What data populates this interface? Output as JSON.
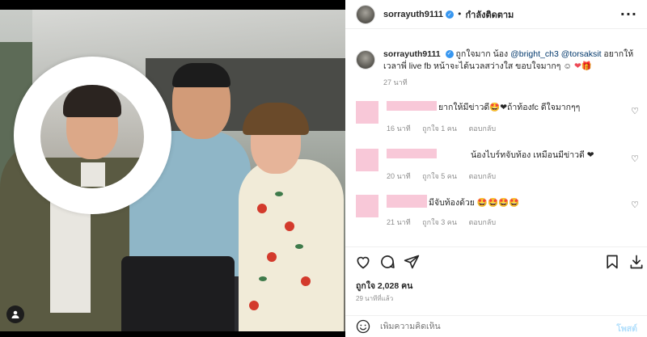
{
  "post": {
    "username": "sorrayuth9111",
    "follow_status": "กำลังติดตาม",
    "more_icon": "more-dots-icon",
    "caption": {
      "username": "sorrayuth9111",
      "text_before": "ถูกใจมาก น้อง ",
      "mention1": "@bright_ch3",
      "mention2": "@torsaksit",
      "text_after": " อยากให้เวลาพี่ live fb หน้าจะได้นวลสว่างใส ขอบใจมากๆ ☺",
      "emoji": "❤🎁",
      "time": "27 นาที"
    },
    "comments": [
      {
        "text": "ยากให้มีข่าวดี🤩❤ถ้าท้องfc ดีใจมากๆๆ",
        "time": "16 นาที",
        "likes": "ถูกใจ 1 คน",
        "reply": "ตอบกลับ"
      },
      {
        "text": "น้องไบร์ทจับท้อง เหมือนมีข่าวดี ❤",
        "time": "20 นาที",
        "likes": "ถูกใจ 5 คน",
        "reply": "ตอบกลับ"
      },
      {
        "text": "มีจับท้องด้วย 🤩🤩🤩🤩",
        "time": "21 นาที",
        "likes": "ถูกใจ 3 คน",
        "reply": "ตอบกลับ"
      }
    ],
    "like_count": "ถูกใจ 2,028 คน",
    "posted_time": "29 นาทีที่แล้ว",
    "add_comment_placeholder": "เพิ่มความคิดเห็น",
    "post_button": "โพสต์"
  },
  "colors": {
    "mention": "#00376b",
    "meta": "#8e8e8e",
    "verified": "#3897f0",
    "post_button": "#b2dffc",
    "redacted": "#f8c8d8"
  }
}
